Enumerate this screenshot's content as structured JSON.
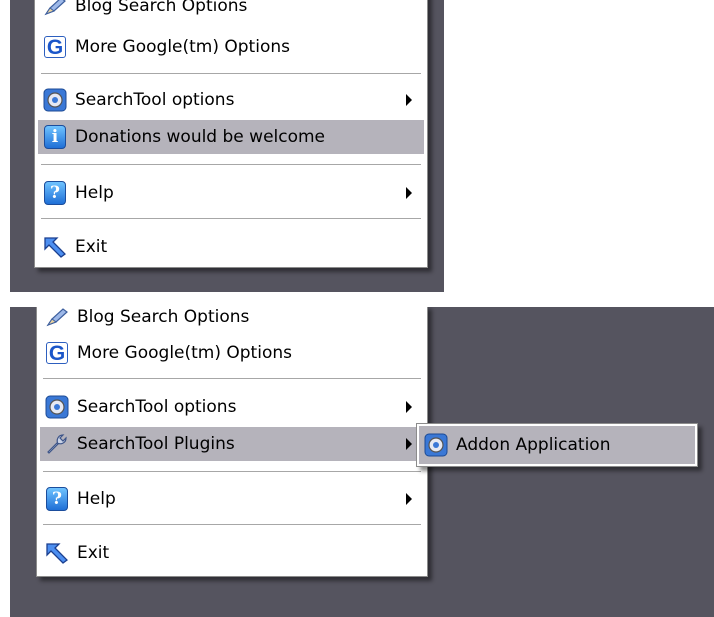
{
  "top_menu": {
    "items": [
      {
        "label": "Blog Search Options",
        "icon": "pencil-icon"
      },
      {
        "label": "More Google(tm) Options",
        "icon": "google-icon"
      },
      {
        "label": "SearchTool options",
        "icon": "gear-icon",
        "submenu": true
      },
      {
        "label": "Donations would be welcome",
        "icon": "info-icon",
        "highlighted": true
      },
      {
        "label": "Help",
        "icon": "help-icon",
        "submenu": true
      },
      {
        "label": "Exit",
        "icon": "exit-arrow-icon"
      }
    ]
  },
  "bottom_menu": {
    "items": [
      {
        "label": "Blog Search Options",
        "icon": "pencil-icon"
      },
      {
        "label": "More Google(tm) Options",
        "icon": "google-icon"
      },
      {
        "label": "SearchTool options",
        "icon": "gear-icon",
        "submenu": true
      },
      {
        "label": "SearchTool Plugins",
        "icon": "wrench-icon",
        "submenu": true,
        "highlighted": true
      },
      {
        "label": "Help",
        "icon": "help-icon",
        "submenu": true
      },
      {
        "label": "Exit",
        "icon": "exit-arrow-icon"
      }
    ],
    "submenu": {
      "items": [
        {
          "label": "Addon Application",
          "icon": "gear-icon",
          "highlighted": true
        }
      ]
    }
  },
  "icon_glyphs": {
    "google": "G",
    "info": "i",
    "help": "?"
  },
  "colors": {
    "desktop_background": "#55545f",
    "menu_background": "#ffffff",
    "highlight": "#b5b3bb"
  }
}
